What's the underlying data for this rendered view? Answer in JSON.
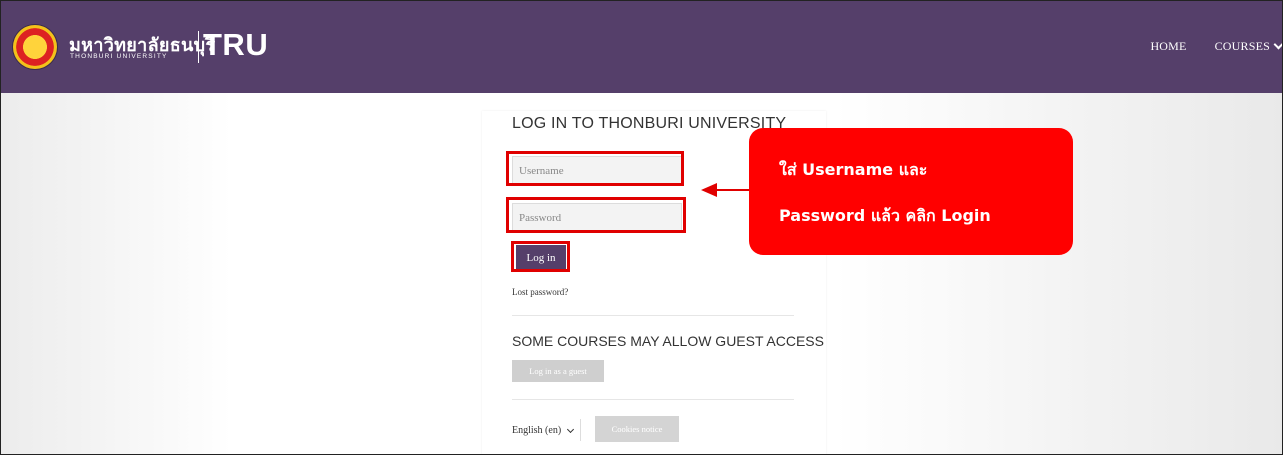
{
  "header": {
    "logo_thai": "มหาวิทยาลัยธนบุรี",
    "logo_english": "THONBURI UNIVERSITY",
    "logo_abbrev": "TRU",
    "nav": [
      {
        "label": "HOME"
      },
      {
        "label": "COURSES"
      }
    ],
    "colors": {
      "navbar": "#553f6a"
    }
  },
  "login": {
    "title": "LOG IN TO THONBURI UNIVERSITY",
    "username_placeholder": "Username",
    "password_placeholder": "Password",
    "login_label": "Log in",
    "lost_password": "Lost password?",
    "guest_title": "SOME COURSES MAY ALLOW GUEST ACCESS",
    "guest_label": "Log in as a guest",
    "language": "English (en)",
    "cookies_label": "Cookies notice"
  },
  "annotation": {
    "line1": "ใส่ Username และ",
    "line2": "Password แล้ว คลิก Login",
    "color": "#ff0000"
  }
}
